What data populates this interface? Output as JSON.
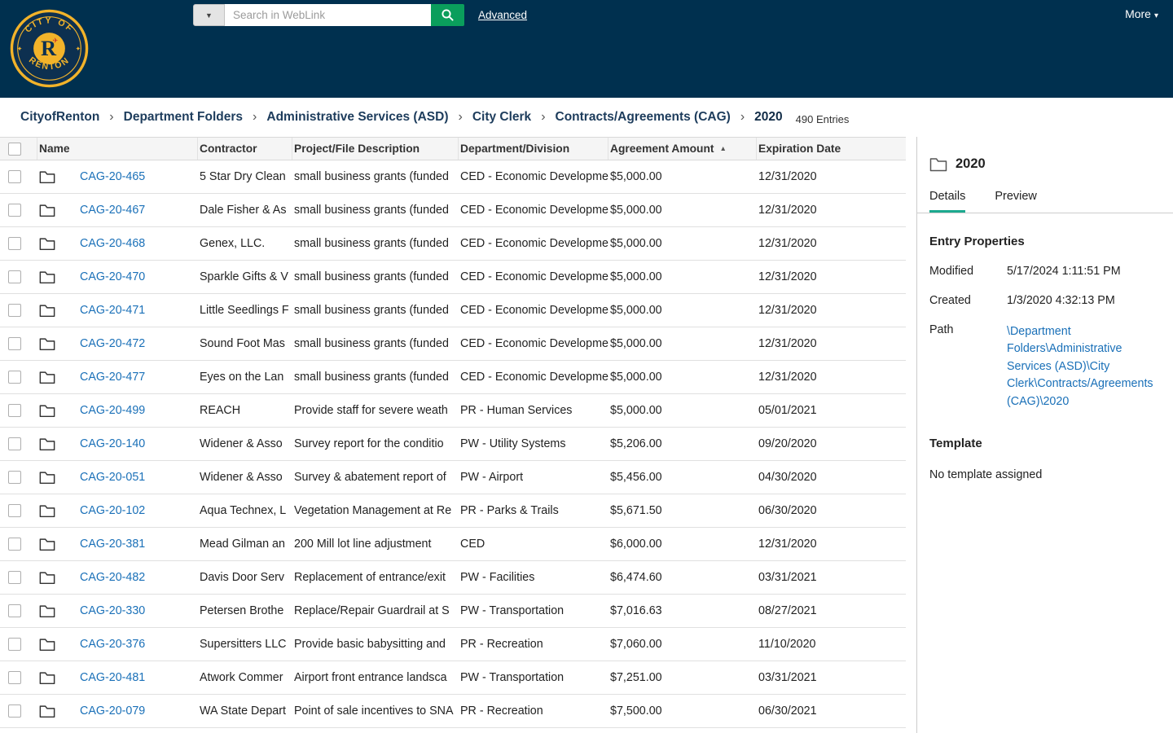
{
  "header": {
    "search_placeholder": "Search in WebLink",
    "advanced_label": "Advanced",
    "more_label": "More",
    "logo_top": "CITY OF",
    "logo_bottom": "RENTON",
    "logo_letter": "R"
  },
  "breadcrumb": {
    "items": [
      "CityofRenton",
      "Department Folders",
      "Administrative Services (ASD)",
      "City Clerk",
      "Contracts/Agreements (CAG)",
      "2020"
    ],
    "entries_count": "490 Entries"
  },
  "table": {
    "columns": [
      "Name",
      "Contractor",
      "Project/File Description",
      "Department/Division",
      "Agreement Amount",
      "Expiration Date"
    ],
    "sort_column": "Agreement Amount",
    "sort_direction": "ascending",
    "rows": [
      {
        "name": "CAG-20-465",
        "contractor": "5 Star Dry Clean",
        "description": "small business grants (funded",
        "department": "CED - Economic Developme",
        "amount": "$5,000.00",
        "expiration": "12/31/2020"
      },
      {
        "name": "CAG-20-467",
        "contractor": "Dale Fisher & As",
        "description": "small business grants (funded",
        "department": "CED - Economic Developme",
        "amount": "$5,000.00",
        "expiration": "12/31/2020"
      },
      {
        "name": "CAG-20-468",
        "contractor": "Genex, LLC.",
        "description": "small business grants (funded",
        "department": "CED - Economic Developme",
        "amount": "$5,000.00",
        "expiration": "12/31/2020"
      },
      {
        "name": "CAG-20-470",
        "contractor": "Sparkle Gifts & V",
        "description": "small business grants (funded",
        "department": "CED - Economic Developme",
        "amount": "$5,000.00",
        "expiration": "12/31/2020"
      },
      {
        "name": "CAG-20-471",
        "contractor": "Little Seedlings F",
        "description": "small business grants (funded",
        "department": "CED - Economic Developme",
        "amount": "$5,000.00",
        "expiration": "12/31/2020"
      },
      {
        "name": "CAG-20-472",
        "contractor": "Sound Foot Mas",
        "description": "small business grants (funded",
        "department": "CED - Economic Developme",
        "amount": "$5,000.00",
        "expiration": "12/31/2020"
      },
      {
        "name": "CAG-20-477",
        "contractor": "Eyes on the Lan",
        "description": "small business grants (funded",
        "department": "CED - Economic Developme",
        "amount": "$5,000.00",
        "expiration": "12/31/2020"
      },
      {
        "name": "CAG-20-499",
        "contractor": "REACH",
        "description": "Provide staff for severe weath",
        "department": "PR - Human Services",
        "amount": "$5,000.00",
        "expiration": "05/01/2021"
      },
      {
        "name": "CAG-20-140",
        "contractor": "Widener & Asso",
        "description": "Survey report for the conditio",
        "department": "PW - Utility Systems",
        "amount": "$5,206.00",
        "expiration": "09/20/2020"
      },
      {
        "name": "CAG-20-051",
        "contractor": "Widener & Asso",
        "description": "Survey & abatement report of",
        "department": "PW - Airport",
        "amount": "$5,456.00",
        "expiration": "04/30/2020"
      },
      {
        "name": "CAG-20-102",
        "contractor": "Aqua Technex, L",
        "description": "Vegetation Management at Re",
        "department": "PR - Parks & Trails",
        "amount": "$5,671.50",
        "expiration": "06/30/2020"
      },
      {
        "name": "CAG-20-381",
        "contractor": "Mead Gilman an",
        "description": "200 Mill lot line adjustment",
        "department": "CED",
        "amount": "$6,000.00",
        "expiration": "12/31/2020"
      },
      {
        "name": "CAG-20-482",
        "contractor": "Davis Door Serv",
        "description": "Replacement of entrance/exit",
        "department": "PW - Facilities",
        "amount": "$6,474.60",
        "expiration": "03/31/2021"
      },
      {
        "name": "CAG-20-330",
        "contractor": "Petersen Brothe",
        "description": "Replace/Repair Guardrail at S",
        "department": "PW - Transportation",
        "amount": "$7,016.63",
        "expiration": "08/27/2021"
      },
      {
        "name": "CAG-20-376",
        "contractor": "Supersitters LLC",
        "description": "Provide basic babysitting and",
        "department": "PR - Recreation",
        "amount": "$7,060.00",
        "expiration": "11/10/2020"
      },
      {
        "name": "CAG-20-481",
        "contractor": "Atwork Commer",
        "description": "Airport front entrance landsca",
        "department": "PW - Transportation",
        "amount": "$7,251.00",
        "expiration": "03/31/2021"
      },
      {
        "name": "CAG-20-079",
        "contractor": "WA State Depart",
        "description": "Point of sale incentives to SNA",
        "department": "PR - Recreation",
        "amount": "$7,500.00",
        "expiration": "06/30/2021"
      }
    ]
  },
  "details_panel": {
    "title": "2020",
    "tabs": [
      "Details",
      "Preview"
    ],
    "active_tab": "Details",
    "section_title": "Entry Properties",
    "properties": [
      {
        "label": "Modified",
        "value": "5/17/2024 1:11:51 PM"
      },
      {
        "label": "Created",
        "value": "1/3/2020 4:32:13 PM"
      },
      {
        "label": "Path",
        "value": "\\Department Folders\\Administrative Services (ASD)\\City Clerk\\Contracts/Agreements (CAG)\\2020"
      }
    ],
    "template_title": "Template",
    "template_value": "No template assigned"
  },
  "colors": {
    "header_navy": "#00304f",
    "search_green": "#0a9e5c",
    "link_blue": "#1a70b8",
    "active_tab_teal": "#1ca98f",
    "logo_gold": "#f2b32a"
  }
}
